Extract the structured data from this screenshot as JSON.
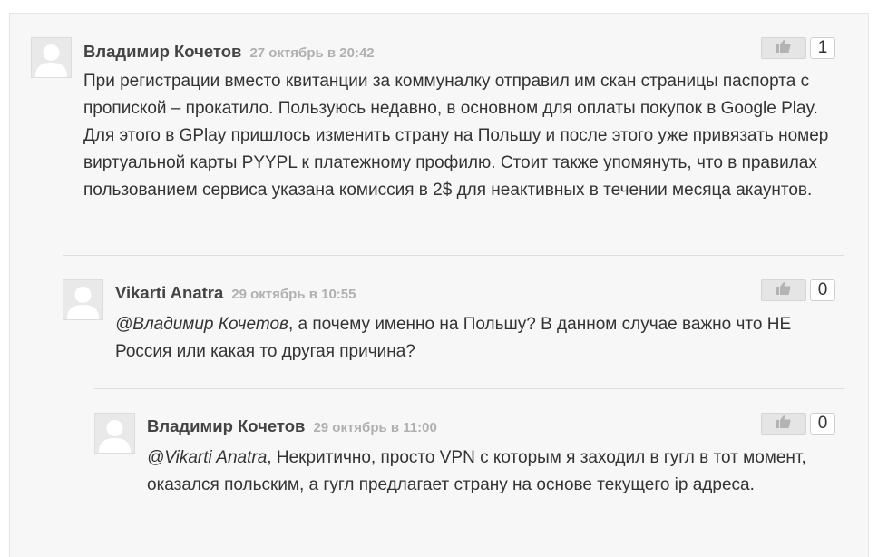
{
  "comments": [
    {
      "author": "Владимир Кочетов",
      "date": "27 октябрь в 20:42",
      "mention": "",
      "text": "При регистрации вместо квитанции за коммуналку отправил им скан страницы паспорта с пропиской – прокатило. Пользуюсь недавно, в основном для оплаты покупок в Google Play. Для этого в GPlay пришлось изменить страну на Польшу и после этого уже привязать номер виртуальной карты PYYPL к платежному профилю. Стоит также упомянуть, что в правилах пользованием сервиса указана комиссия в 2$ для неактивных в течении месяца  акаунтов.",
      "likes": "1",
      "icons": {
        "avatar": "user-avatar-icon",
        "like": "thumbs-up-icon"
      }
    },
    {
      "author": "Vikarti Anatra",
      "date": "29 октябрь в 10:55",
      "mention": "@Владимир Кочетов",
      "text": ", а почему именно на Польшу? В данном случае важно что НЕ Россия или какая то другая причина?",
      "likes": "0",
      "icons": {
        "avatar": "user-avatar-icon",
        "like": "thumbs-up-icon"
      }
    },
    {
      "author": "Владимир Кочетов",
      "date": "29 октябрь в 11:00",
      "mention": "@Vikarti Anatra",
      "text": ", Некритично, просто VPN с которым я заходил в гугл в тот момент, оказался польским, а гугл предлагает страну на основе текущего ip адреса.",
      "likes": "0",
      "icons": {
        "avatar": "user-avatar-icon",
        "like": "thumbs-up-icon"
      }
    }
  ],
  "colors": {
    "panel": "#f7f7f7",
    "date": "#b0b0b0",
    "author": "#444444"
  }
}
